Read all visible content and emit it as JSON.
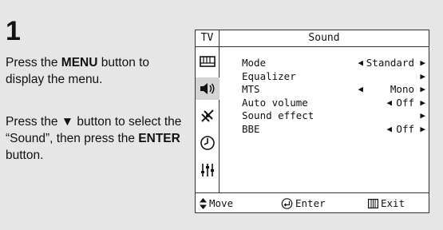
{
  "step": {
    "number": "1"
  },
  "instructions": {
    "p1": {
      "pre": "Press the ",
      "bold": "MENU",
      "post": " button to display the menu."
    },
    "p2": {
      "pre": "Press the ▼ button to select the “Sound”, then press the ",
      "bold": "ENTER",
      "post": " button."
    }
  },
  "osd": {
    "tab": "TV",
    "title": "Sound",
    "side_icons": [
      "picture-icon",
      "sound-icon",
      "channel-icon",
      "clock-icon",
      "setup-icon"
    ],
    "rows": [
      {
        "label": "Mode",
        "value": "Standard",
        "left_arrow": true,
        "right_arrow": true
      },
      {
        "label": "Equalizer",
        "value": "",
        "left_arrow": false,
        "right_arrow": true
      },
      {
        "label": "MTS",
        "value": "Mono",
        "left_arrow": true,
        "right_arrow": true
      },
      {
        "label": "Auto volume",
        "value": "Off",
        "left_arrow": true,
        "right_arrow": true
      },
      {
        "label": "Sound effect",
        "value": "",
        "left_arrow": false,
        "right_arrow": true
      },
      {
        "label": "BBE",
        "value": "Off",
        "left_arrow": true,
        "right_arrow": true
      }
    ],
    "bottom": {
      "move": "Move",
      "enter": "Enter",
      "exit": "Exit"
    }
  }
}
